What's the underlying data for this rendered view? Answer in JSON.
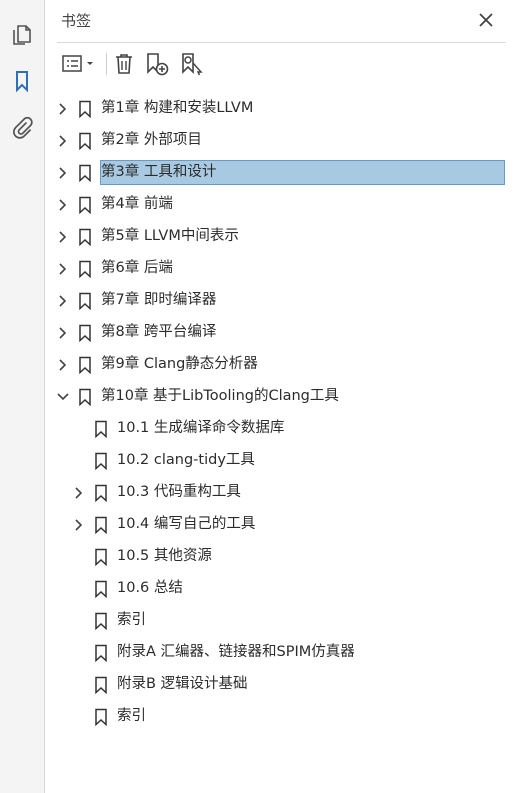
{
  "panel": {
    "title": "书签"
  },
  "bookmarks": [
    {
      "label": "第1章 构建和安装LLVM",
      "level": 0,
      "expander": "collapsed",
      "selected": false
    },
    {
      "label": "第2章 外部项目",
      "level": 0,
      "expander": "collapsed",
      "selected": false
    },
    {
      "label": "第3章 工具和设计",
      "level": 0,
      "expander": "collapsed",
      "selected": true
    },
    {
      "label": "第4章 前端",
      "level": 0,
      "expander": "collapsed",
      "selected": false
    },
    {
      "label": "第5章 LLVM中间表示",
      "level": 0,
      "expander": "collapsed",
      "selected": false
    },
    {
      "label": "第6章 后端",
      "level": 0,
      "expander": "collapsed",
      "selected": false
    },
    {
      "label": "第7章 即时编译器",
      "level": 0,
      "expander": "collapsed",
      "selected": false
    },
    {
      "label": "第8章 跨平台编译",
      "level": 0,
      "expander": "collapsed",
      "selected": false
    },
    {
      "label": "第9章 Clang静态分析器",
      "level": 0,
      "expander": "collapsed",
      "selected": false
    },
    {
      "label": "第10章 基于LibTooling的Clang工具",
      "level": 0,
      "expander": "expanded",
      "selected": false
    },
    {
      "label": "10.1 生成编译命令数据库",
      "level": 1,
      "expander": "none",
      "selected": false
    },
    {
      "label": "10.2 clang-tidy工具",
      "level": 1,
      "expander": "none",
      "selected": false
    },
    {
      "label": "10.3 代码重构工具",
      "level": 1,
      "expander": "collapsed",
      "selected": false
    },
    {
      "label": "10.4 编写自己的工具",
      "level": 1,
      "expander": "collapsed",
      "selected": false
    },
    {
      "label": "10.5 其他资源",
      "level": 1,
      "expander": "none",
      "selected": false
    },
    {
      "label": "10.6 总结",
      "level": 1,
      "expander": "none",
      "selected": false
    },
    {
      "label": "索引",
      "level": 1,
      "expander": "none",
      "selected": false
    },
    {
      "label": "附录A  汇编器、链接器和SPIM仿真器",
      "level": 1,
      "expander": "none",
      "selected": false
    },
    {
      "label": "附录B  逻辑设计基础",
      "level": 1,
      "expander": "none",
      "selected": false
    },
    {
      "label": "索引",
      "level": 1,
      "expander": "none",
      "selected": false
    }
  ],
  "colors": {
    "selection_fill": "#a7c9e2",
    "selection_border": "#6a9cc2",
    "active_rail_icon": "#2f6fb5"
  }
}
